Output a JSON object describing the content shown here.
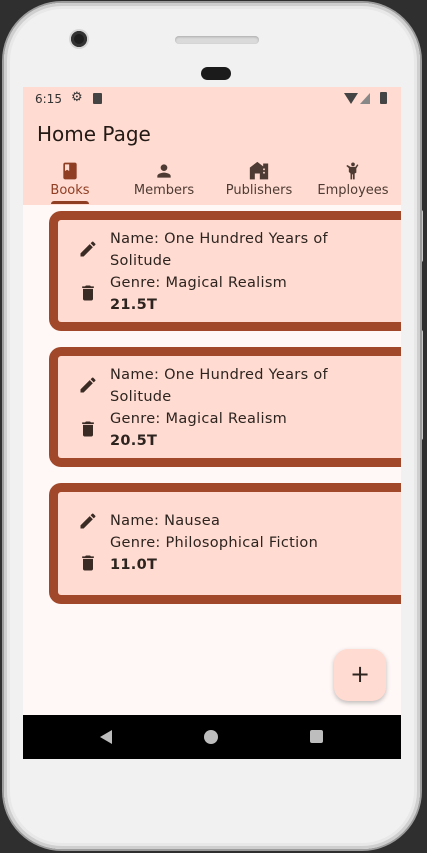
{
  "status_bar": {
    "time": "6:15"
  },
  "app_bar": {
    "title": "Home Page"
  },
  "tabs": [
    {
      "label": "Books",
      "icon": "book-icon",
      "active": true
    },
    {
      "label": "Members",
      "icon": "person-icon",
      "active": false
    },
    {
      "label": "Publishers",
      "icon": "building-icon",
      "active": false
    },
    {
      "label": "Employees",
      "icon": "employee-icon",
      "active": false
    }
  ],
  "books": [
    {
      "name": "Name: One Hundred Years of Solitude",
      "genre": "Genre: Magical Realism",
      "price": "21.5T"
    },
    {
      "name": "Name: One Hundred Years of Solitude",
      "genre": "Genre: Magical Realism",
      "price": "20.5T"
    },
    {
      "name": "Name: Nausea",
      "genre": "Genre: Philosophical Fiction",
      "price": "11.0T"
    }
  ],
  "fab": {
    "label": "+"
  },
  "colors": {
    "accent": "#8f3e24",
    "card_border": "#a1472a",
    "surface": "#ffdbd1",
    "background": "#fff8f7"
  }
}
